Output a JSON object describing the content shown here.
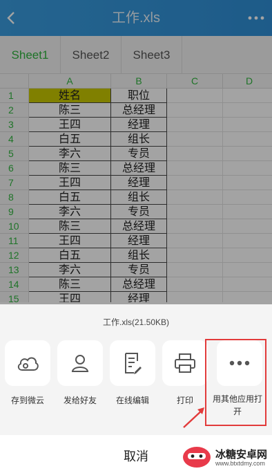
{
  "header": {
    "title": "工作.xls",
    "back_icon": "chevron-left-icon",
    "more_icon": "ellipsis-icon"
  },
  "tabs": [
    {
      "label": "Sheet1",
      "active": true
    },
    {
      "label": "Sheet2",
      "active": false
    },
    {
      "label": "Sheet3",
      "active": false
    }
  ],
  "grid": {
    "columns": [
      "A",
      "B",
      "C",
      "D"
    ],
    "rows": [
      {
        "n": "1",
        "a": "姓名",
        "b": "职位"
      },
      {
        "n": "2",
        "a": "陈三",
        "b": "总经理"
      },
      {
        "n": "3",
        "a": "王四",
        "b": "经理"
      },
      {
        "n": "4",
        "a": "白五",
        "b": "组长"
      },
      {
        "n": "5",
        "a": "李六",
        "b": "专员"
      },
      {
        "n": "6",
        "a": "陈三",
        "b": "总经理"
      },
      {
        "n": "7",
        "a": "王四",
        "b": "经理"
      },
      {
        "n": "8",
        "a": "白五",
        "b": "组长"
      },
      {
        "n": "9",
        "a": "李六",
        "b": "专员"
      },
      {
        "n": "10",
        "a": "陈三",
        "b": "总经理"
      },
      {
        "n": "11",
        "a": "王四",
        "b": "经理"
      },
      {
        "n": "12",
        "a": "白五",
        "b": "组长"
      },
      {
        "n": "13",
        "a": "李六",
        "b": "专员"
      },
      {
        "n": "14",
        "a": "陈三",
        "b": "总经理"
      },
      {
        "n": "15",
        "a": "王四",
        "b": "经理"
      }
    ],
    "highlight_color": "#c8c800"
  },
  "sheet": {
    "file_info": "工作.xls(21.50KB)",
    "actions": [
      {
        "label": "存到微云",
        "icon": "cloud-icon"
      },
      {
        "label": "发给好友",
        "icon": "person-icon"
      },
      {
        "label": "在线编辑",
        "icon": "edit-document-icon"
      },
      {
        "label": "打印",
        "icon": "printer-icon"
      },
      {
        "label": "用其他应用打开",
        "icon": "more-dots-icon"
      }
    ],
    "cancel_label": "取消"
  },
  "watermark": {
    "brand": "冰糖安卓网",
    "url": "www.btxtdmy.com"
  },
  "colors": {
    "header": "#2f8fd6",
    "accent_green": "#2fb53d",
    "annotation_red": "#e23a3a"
  }
}
